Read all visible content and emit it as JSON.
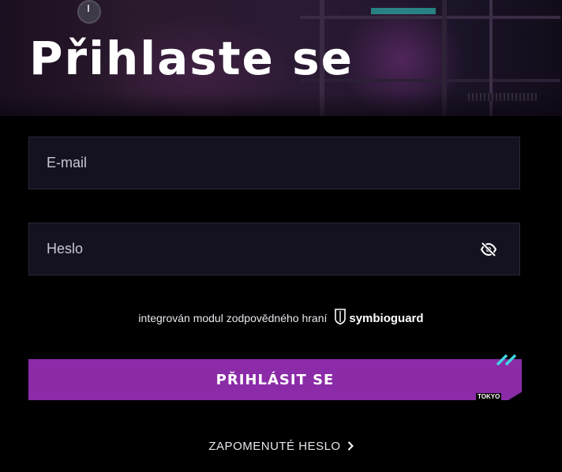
{
  "hero": {
    "title": "Přihlaste se"
  },
  "form": {
    "email": {
      "placeholder": "E-mail",
      "value": ""
    },
    "password": {
      "placeholder": "Heslo",
      "value": ""
    },
    "password_toggle_icon": "eye-slash-icon"
  },
  "responsible_gaming": {
    "text": "integrován modul zodpovědného hraní",
    "brand": "symbioguard",
    "brand_icon": "shield-icon"
  },
  "login_button": {
    "label": "PŘIHLÁSIT SE",
    "tag": "TOKYO",
    "color": "#8b2ba8",
    "accent_color": "#3fd6e0"
  },
  "forgot_password": {
    "label": "ZAPOMENUTÉ HESLO",
    "icon": "chevron-right-icon"
  }
}
